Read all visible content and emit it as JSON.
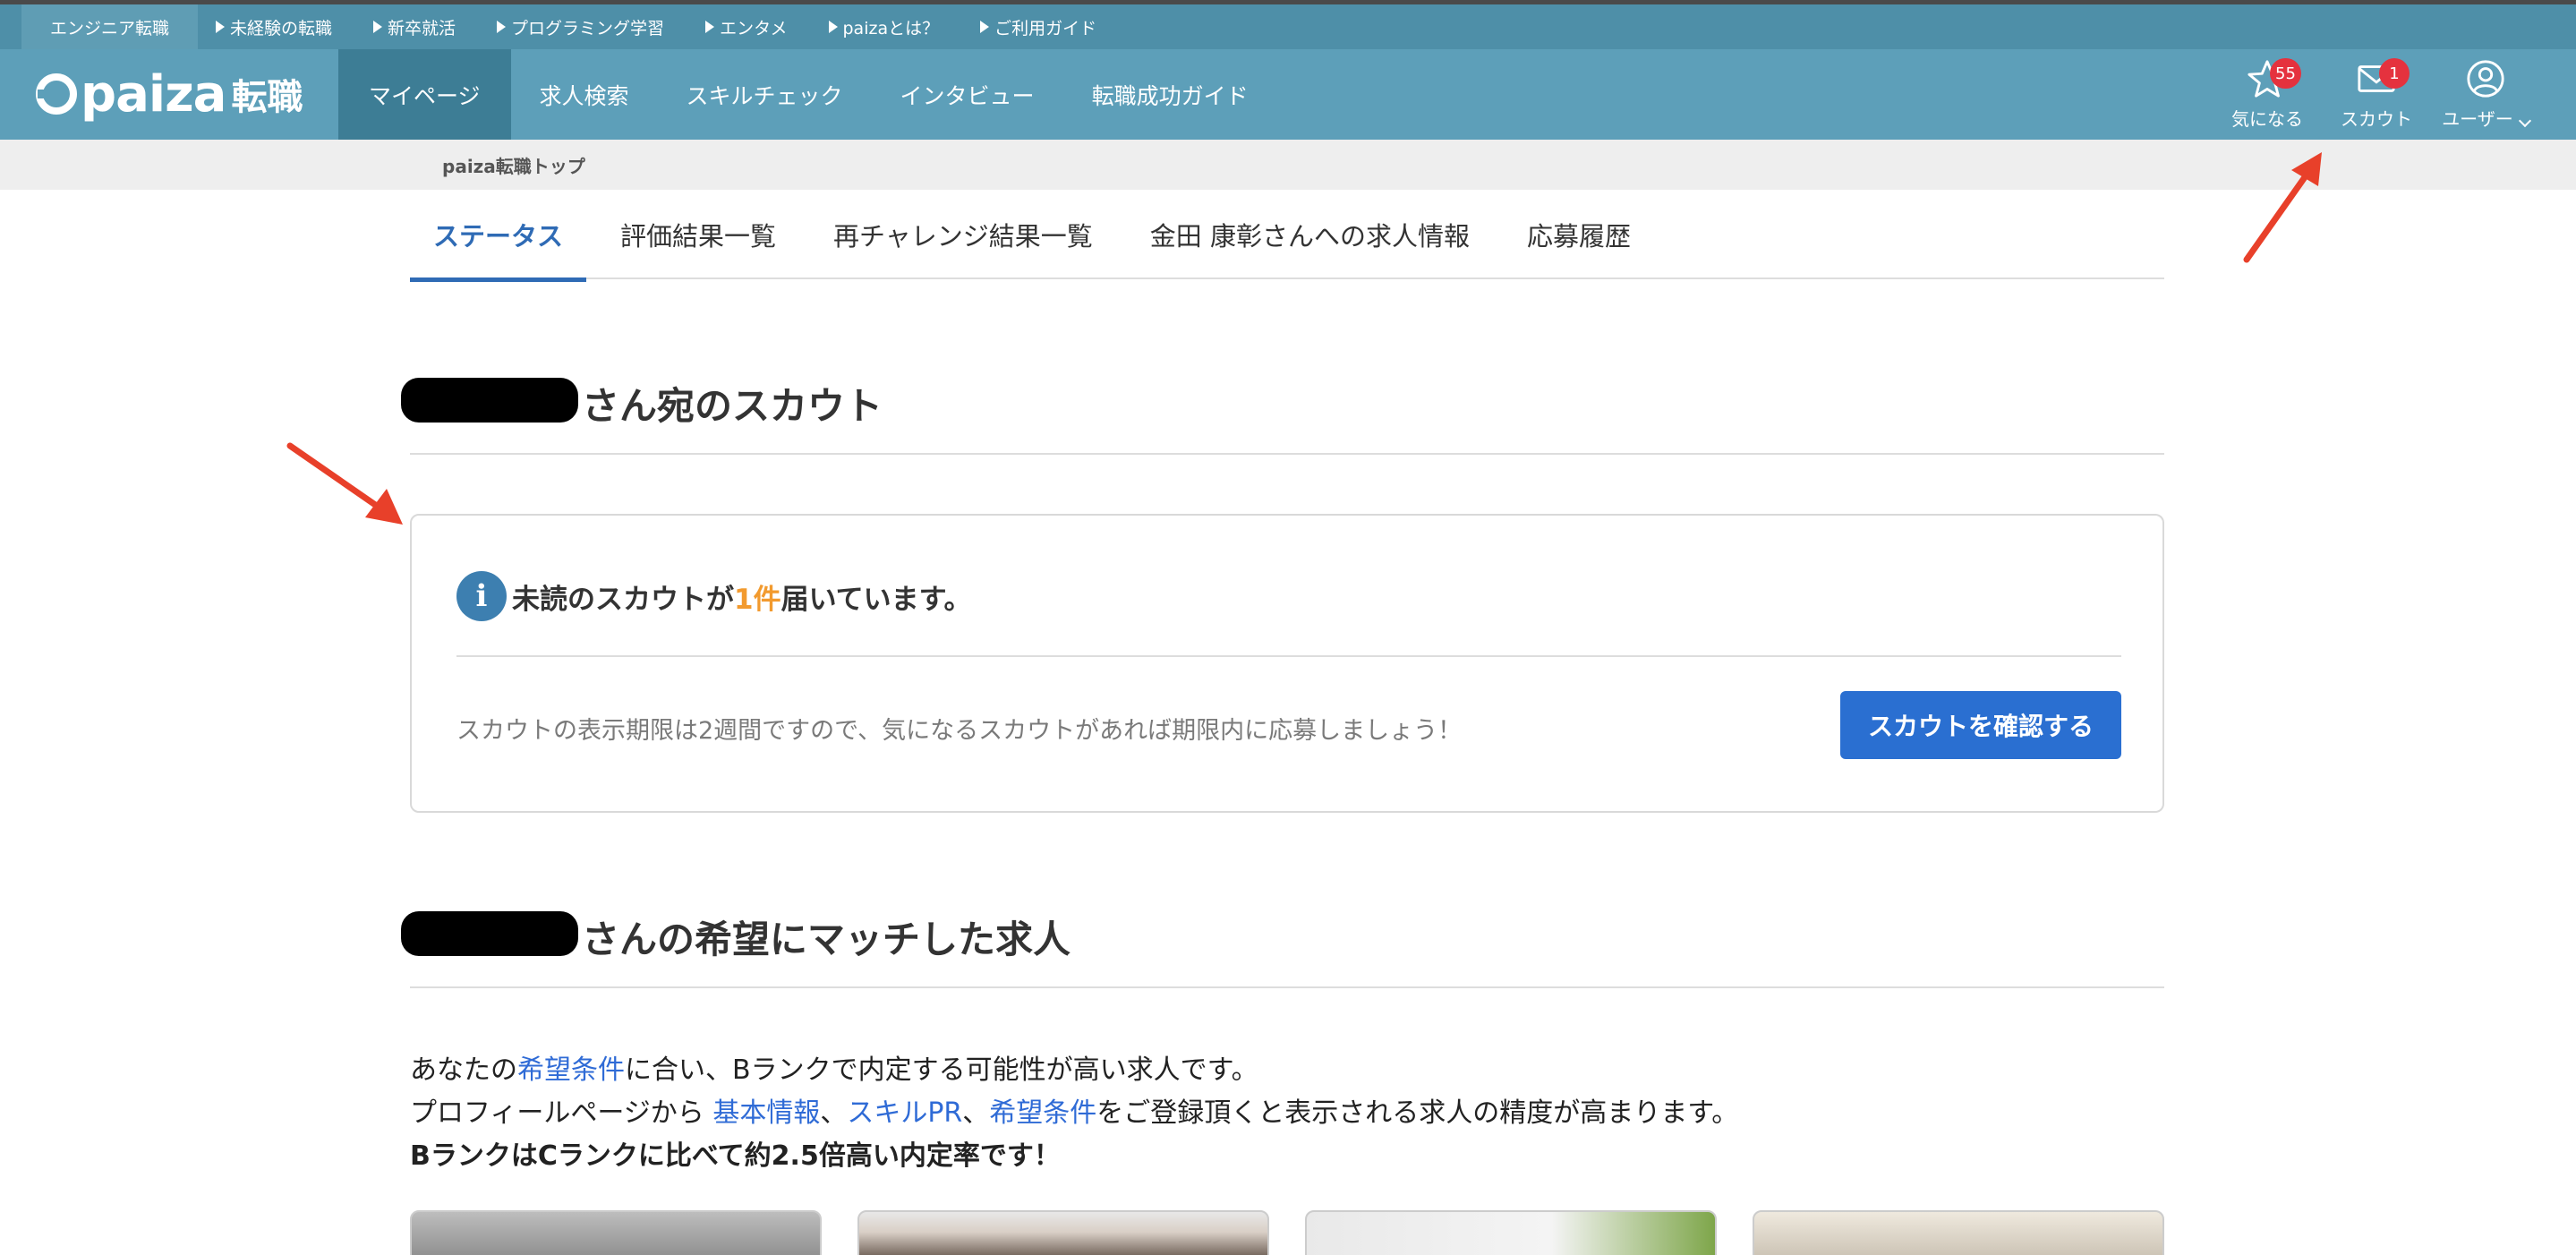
{
  "subnav": {
    "items": [
      "エンジニア転職",
      "未経験の転職",
      "新卒就活",
      "プログラミング学習",
      "エンタメ",
      "paizaとは？",
      "ご利用ガイド"
    ]
  },
  "header": {
    "logo_word": "paiza",
    "logo_tenshoku": "転職",
    "nav": [
      "マイページ",
      "求人検索",
      "スキルチェック",
      "インタビュー",
      "転職成功ガイド"
    ],
    "icons": {
      "favorite": {
        "label": "気になる",
        "badge": "55",
        "icon": "star-icon"
      },
      "scout": {
        "label": "スカウト",
        "badge": "1",
        "icon": "mail-icon"
      },
      "user": {
        "label": "ユーザー",
        "icon": "user-icon"
      }
    }
  },
  "breadcrumb": "paiza転職トップ",
  "tabs": [
    "ステータス",
    "評価結果一覧",
    "再チャレンジ結果一覧",
    "金田 康彰さんへの求人情報",
    "応募履歴"
  ],
  "scout_section": {
    "title": "さん宛のスカウト",
    "unread_prefix": "未読のスカウトが",
    "unread_count": "1件",
    "unread_suffix": "届いています。",
    "notice": "スカウトの表示期限は2週間ですので、気になるスカウトがあれば期限内に応募しましょう！",
    "button": "スカウトを確認する"
  },
  "match_section": {
    "title": "さんの希望にマッチした求人",
    "line1_prefix": "あなたの",
    "line1_link": "希望条件",
    "line1_suffix": "に合い、Bランクで内定する可能性が高い求人です。",
    "line2_prefix": "プロフィールページから ",
    "line2_link1": "基本情報",
    "sep1": "、",
    "line2_link2": "スキルPR",
    "sep2": "、",
    "line2_link3": "希望条件",
    "line2_suffix": "をご登録頂くと表示される求人の精度が高まります。",
    "line3": "BランクはCランクに比べて約2.5倍高い内定率です！"
  },
  "colors": {
    "header": "#5d9fb9",
    "subnav": "#4e8fa8",
    "accent": "#2f6bb5",
    "button": "#2a6fd1",
    "highlight": "#f29a2e",
    "badge": "#e5323e",
    "annotation_arrow": "#e8402a"
  }
}
